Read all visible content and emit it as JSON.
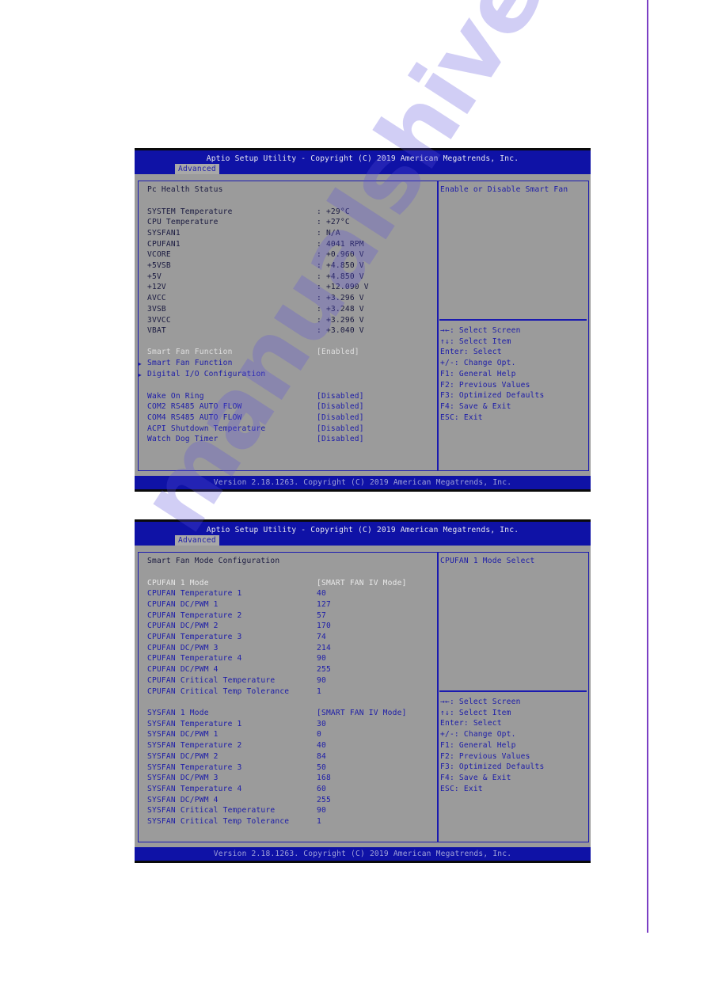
{
  "colors": {
    "header_blue": "#0f12a6",
    "body_gray": "#9b9b9b",
    "text_blue": "#1c1ca8",
    "border_blue": "#1a1ab0",
    "page_line": "#7b3fc4"
  },
  "watermark": "manualshive.com",
  "screens": [
    {
      "title": "Aptio Setup Utility - Copyright (C) 2019 American Megatrends, Inc.",
      "tab": "Advanced",
      "heading": "Pc Health Status",
      "readings": [
        {
          "label": "SYSTEM Temperature",
          "value": ": +29°C"
        },
        {
          "label": "CPU Temperature",
          "value": ": +27°C"
        },
        {
          "label": "SYSFAN1",
          "value": ": N/A"
        },
        {
          "label": "CPUFAN1",
          "value": ": 4041 RPM"
        },
        {
          "label": "VCORE",
          "value": ": +0.960 V"
        },
        {
          "label": "+5VSB",
          "value": ": +4.850 V"
        },
        {
          "label": "+5V",
          "value": ": +4.850 V"
        },
        {
          "label": "+12V",
          "value": ": +12.090 V"
        },
        {
          "label": "AVCC",
          "value": ": +3.296 V"
        },
        {
          "label": "3VSB",
          "value": ": +3.248 V"
        },
        {
          "label": "3VVCC",
          "value": ": +3.296 V"
        },
        {
          "label": "VBAT",
          "value": ": +3.040 V"
        }
      ],
      "selected_option": {
        "label": "Smart Fan Function",
        "value": "[Enabled]"
      },
      "submenus": [
        {
          "icon": "submenu-arrow-icon",
          "label": "Smart Fan Function"
        },
        {
          "icon": "submenu-arrow-icon",
          "label": "Digital I/O Configuration"
        }
      ],
      "options": [
        {
          "label": "Wake On Ring",
          "value": "[Disabled]"
        },
        {
          "label": "COM2 RS485 AUTO FLOW",
          "value": "[Disabled]"
        },
        {
          "label": "COM4 RS485 AUTO FLOW",
          "value": "[Disabled]"
        },
        {
          "label": "ACPI Shutdown Temperature",
          "value": "[Disabled]"
        },
        {
          "label": "Watch Dog Timer",
          "value": "[Disabled]"
        }
      ],
      "help_text": "Enable or Disable Smart Fan",
      "key_help": [
        "→←: Select Screen",
        "↑↓: Select Item",
        "Enter: Select",
        "+/-: Change Opt.",
        "F1: General Help",
        "F2: Previous Values",
        "F3: Optimized Defaults",
        "F4: Save & Exit",
        "ESC: Exit"
      ],
      "footer": "Version 2.18.1263. Copyright (C) 2019 American Megatrends, Inc."
    },
    {
      "title": "Aptio Setup Utility - Copyright (C) 2019 American Megatrends, Inc.",
      "tab": "Advanced",
      "heading": "Smart Fan Mode Configuration",
      "cpufan": [
        {
          "label": "CPUFAN 1 Mode",
          "value": "[SMART FAN IV Mode]"
        },
        {
          "label": "CPUFAN Temperature 1",
          "value": "40"
        },
        {
          "label": "CPUFAN DC/PWM 1",
          "value": "127"
        },
        {
          "label": "CPUFAN Temperature 2",
          "value": "57"
        },
        {
          "label": "CPUFAN DC/PWM 2",
          "value": "170"
        },
        {
          "label": "CPUFAN Temperature 3",
          "value": "74"
        },
        {
          "label": "CPUFAN DC/PWM 3",
          "value": "214"
        },
        {
          "label": "CPUFAN Temperature 4",
          "value": "90"
        },
        {
          "label": "CPUFAN DC/PWM 4",
          "value": "255"
        },
        {
          "label": "CPUFAN Critical Temperature",
          "value": "90"
        },
        {
          "label": "CPUFAN Critical Temp Tolerance",
          "value": "1"
        }
      ],
      "sysfan": [
        {
          "label": "SYSFAN 1 Mode",
          "value": "[SMART FAN IV Mode]"
        },
        {
          "label": "SYSFAN Temperature 1",
          "value": "30"
        },
        {
          "label": "SYSFAN DC/PWM 1",
          "value": "0"
        },
        {
          "label": "SYSFAN Temperature 2",
          "value": "40"
        },
        {
          "label": "SYSFAN DC/PWM 2",
          "value": "84"
        },
        {
          "label": "SYSFAN Temperature 3",
          "value": "50"
        },
        {
          "label": "SYSFAN DC/PWM 3",
          "value": "168"
        },
        {
          "label": "SYSFAN Temperature 4",
          "value": "60"
        },
        {
          "label": "SYSFAN DC/PWM 4",
          "value": "255"
        },
        {
          "label": "SYSFAN Critical Temperature",
          "value": "90"
        },
        {
          "label": "SYSFAN Critical Temp Tolerance",
          "value": "1"
        }
      ],
      "help_text": "CPUFAN 1 Mode Select",
      "key_help": [
        "→←: Select Screen",
        "↑↓: Select Item",
        "Enter: Select",
        "+/-: Change Opt.",
        "F1: General Help",
        "F2: Previous Values",
        "F3: Optimized Defaults",
        "F4: Save & Exit",
        "ESC: Exit"
      ],
      "footer": "Version 2.18.1263. Copyright (C) 2019 American Megatrends, Inc."
    }
  ]
}
